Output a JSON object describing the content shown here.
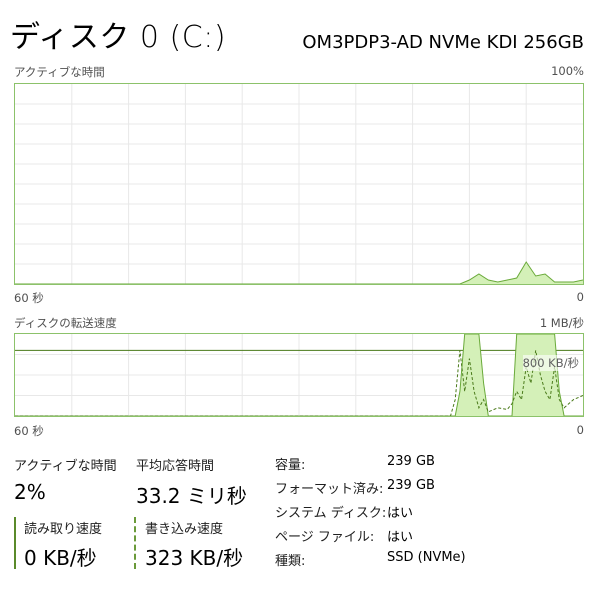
{
  "header": {
    "title": "ディスク 0 (C:)",
    "model": "OM3PDP3-AD NVMe KDI 256GB"
  },
  "active_time_graph": {
    "label": "アクティブな時間",
    "max_label": "100%",
    "x_left_label": "60 秒",
    "x_right_label": "0"
  },
  "transfer_graph": {
    "label": "ディスクの転送速度",
    "max_label": "1 MB/秒",
    "ref_line_label": "800 KB/秒",
    "x_left_label": "60 秒",
    "x_right_label": "0"
  },
  "stats": {
    "active_time": {
      "label": "アクティブな時間",
      "value": "2%"
    },
    "avg_response": {
      "label": "平均応答時間",
      "value": "33.2 ミリ秒"
    },
    "read_speed": {
      "label": "読み取り速度",
      "value": "0 KB/秒"
    },
    "write_speed": {
      "label": "書き込み速度",
      "value": "323 KB/秒"
    }
  },
  "properties": [
    {
      "label": "容量:",
      "value": "239 GB"
    },
    {
      "label": "フォーマット済み:",
      "value": "239 GB"
    },
    {
      "label": "システム ディスク:",
      "value": "はい"
    },
    {
      "label": "ページ ファイル:",
      "value": "はい"
    },
    {
      "label": "種類:",
      "value": "SSD (NVMe)"
    }
  ],
  "colors": {
    "accent": "#8cc26a",
    "fill": "#d4f0b8",
    "line": "#6aaa3a",
    "grid": "#e8e8e8"
  },
  "chart_data": [
    {
      "type": "area",
      "title": "アクティブな時間",
      "xlabel": "",
      "ylabel": "",
      "x": [
        60,
        57,
        54,
        51,
        48,
        45,
        42,
        39,
        36,
        33,
        30,
        27,
        24,
        21,
        18,
        15,
        13,
        12,
        11,
        10,
        9,
        8,
        7,
        6,
        5,
        4,
        3,
        2,
        1,
        0
      ],
      "series": [
        {
          "values": [
            0,
            0,
            0,
            0,
            0,
            0,
            0,
            0,
            0,
            0,
            0,
            0,
            0,
            0,
            0,
            0,
            0,
            2,
            5,
            2,
            1,
            2,
            3,
            11,
            4,
            5,
            1,
            1,
            1,
            2
          ]
        }
      ],
      "xlim": [
        60,
        0
      ],
      "ylim": [
        0,
        100
      ],
      "grid": true
    },
    {
      "type": "area",
      "title": "ディスクの転送速度",
      "xlabel": "",
      "ylabel": "",
      "x": [
        60,
        50,
        40,
        30,
        20,
        15,
        14,
        13.5,
        13,
        12.5,
        12,
        11.5,
        11,
        10.5,
        10,
        9,
        8,
        7.5,
        7,
        6.5,
        6,
        5.5,
        5,
        4.5,
        4,
        3.5,
        3,
        2.5,
        2,
        1,
        0
      ],
      "series": [
        {
          "name": "write",
          "values": [
            0,
            0,
            0,
            0,
            0,
            0,
            0,
            0,
            300,
            1000,
            1000,
            1000,
            1000,
            400,
            0,
            0,
            0,
            0,
            1000,
            1000,
            1000,
            1000,
            1000,
            1000,
            1000,
            1000,
            1000,
            300,
            0,
            0,
            0
          ]
        },
        {
          "name": "read",
          "values": [
            0,
            0,
            0,
            0,
            0,
            0,
            0,
            200,
            800,
            300,
            700,
            300,
            100,
            200,
            50,
            100,
            80,
            150,
            300,
            200,
            600,
            400,
            800,
            500,
            300,
            200,
            600,
            200,
            100,
            200,
            250
          ]
        }
      ],
      "xlim": [
        60,
        0
      ],
      "ylim": [
        0,
        1000
      ],
      "grid": true
    }
  ]
}
